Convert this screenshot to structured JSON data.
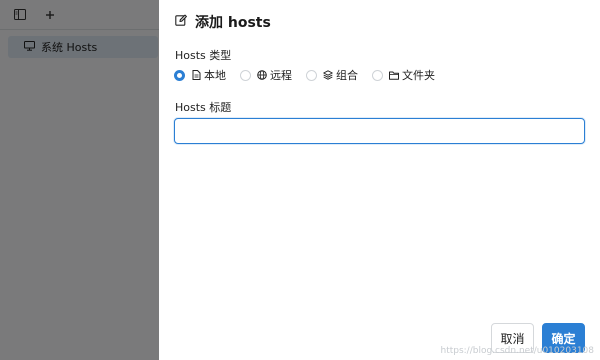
{
  "sidebar": {
    "items": [
      {
        "label": "系统 Hosts",
        "icon": "monitor-icon"
      }
    ]
  },
  "topbar": {
    "icons": [
      "sidebar-toggle-icon",
      "plus-icon"
    ]
  },
  "drawer": {
    "title": "添加 hosts",
    "title_icon": "edit-icon",
    "type_label": "Hosts 类型",
    "type_options": [
      {
        "label": "本地",
        "icon": "file-icon",
        "checked": true
      },
      {
        "label": "远程",
        "icon": "globe-icon",
        "checked": false
      },
      {
        "label": "组合",
        "icon": "layers-icon",
        "checked": false
      },
      {
        "label": "文件夹",
        "icon": "folder-icon",
        "checked": false
      }
    ],
    "hosts_title_label": "Hosts 标题",
    "hosts_title_value": "",
    "cancel_label": "取消",
    "ok_label": "确定"
  },
  "colors": {
    "accent": "#2b7fd4",
    "overlay": "rgba(0,0,0,0.5)",
    "sidebar_selected": "#dbe5ef"
  },
  "watermark": "https://blog.csdn.net/u010203108"
}
